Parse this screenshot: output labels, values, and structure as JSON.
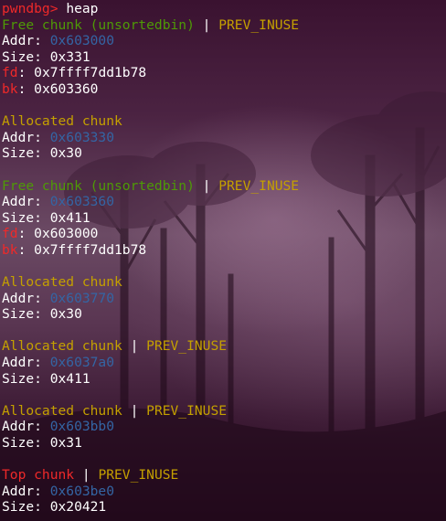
{
  "prompt": "pwndbg>",
  "command": "heap",
  "chunks": [
    {
      "type": "Free chunk (unsortedbin)",
      "flag": "PREV_INUSE",
      "addr": "0x603000",
      "size": "0x331",
      "fd": "0x7ffff7dd1b78",
      "bk": "0x603360"
    },
    {
      "type": "Allocated chunk",
      "addr": "0x603330",
      "size": "0x30"
    },
    {
      "type": "Free chunk (unsortedbin)",
      "flag": "PREV_INUSE",
      "addr": "0x603360",
      "size": "0x411",
      "fd": "0x603000",
      "bk": "0x7ffff7dd1b78"
    },
    {
      "type": "Allocated chunk",
      "addr": "0x603770",
      "size": "0x30"
    },
    {
      "type": "Allocated chunk",
      "flag": "PREV_INUSE",
      "addr": "0x6037a0",
      "size": "0x411"
    },
    {
      "type": "Allocated chunk",
      "flag": "PREV_INUSE",
      "addr": "0x603bb0",
      "size": "0x31"
    },
    {
      "type": "Top chunk",
      "flag": "PREV_INUSE",
      "addr": "0x603be0",
      "size": "0x20421"
    }
  ],
  "labels": {
    "separator": " | ",
    "addr": "Addr: ",
    "size": "Size: ",
    "fd": "fd",
    "bk": "bk",
    "colon": ": "
  },
  "colors": {
    "prompt": "#ef2929",
    "free_chunk": "#4e9a06",
    "allocated_chunk": "#c4a000",
    "top_chunk": "#ef2929",
    "flag": "#c4a000",
    "address": "#3465a4",
    "pointer_label": "#ef2929",
    "text": "#ffffff"
  }
}
